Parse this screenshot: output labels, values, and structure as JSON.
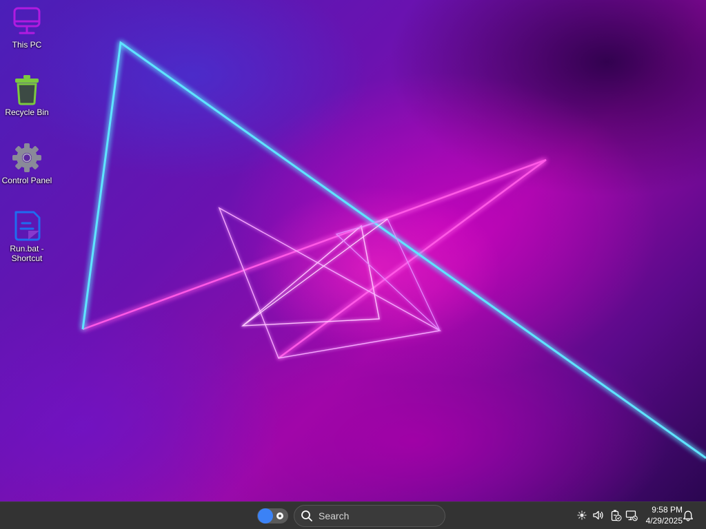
{
  "desktop": {
    "icons": [
      {
        "name": "this-pc",
        "label": "This PC",
        "icon": "monitor-icon",
        "color": "#b01be0"
      },
      {
        "name": "recycle-bin",
        "label": "Recycle Bin",
        "icon": "trash-icon",
        "color": "#7cc940"
      },
      {
        "name": "control-panel",
        "label": "Control Panel",
        "icon": "gear-icon",
        "color": "#8a8a99"
      },
      {
        "name": "run-bat-shortcut",
        "label": "Run.bat -\nShortcut",
        "icon": "document-icon",
        "color": "#1f6cf0"
      }
    ]
  },
  "taskbar": {
    "toggle_icon": "task-view-toggle-icon",
    "search": {
      "placeholder": "Search",
      "icon": "search-icon"
    },
    "tray": {
      "icons": [
        "brightness-icon",
        "volume-icon",
        "battery-icon",
        "network-icon",
        "bell-icon"
      ]
    },
    "clock": {
      "time": "9:58 PM",
      "date": "4/29/2025"
    }
  },
  "colors": {
    "taskbar_bg": "#333333",
    "accent": "#3b82f6",
    "neon_cyan": "#39d7ff",
    "neon_pink": "#ff3fe0"
  }
}
